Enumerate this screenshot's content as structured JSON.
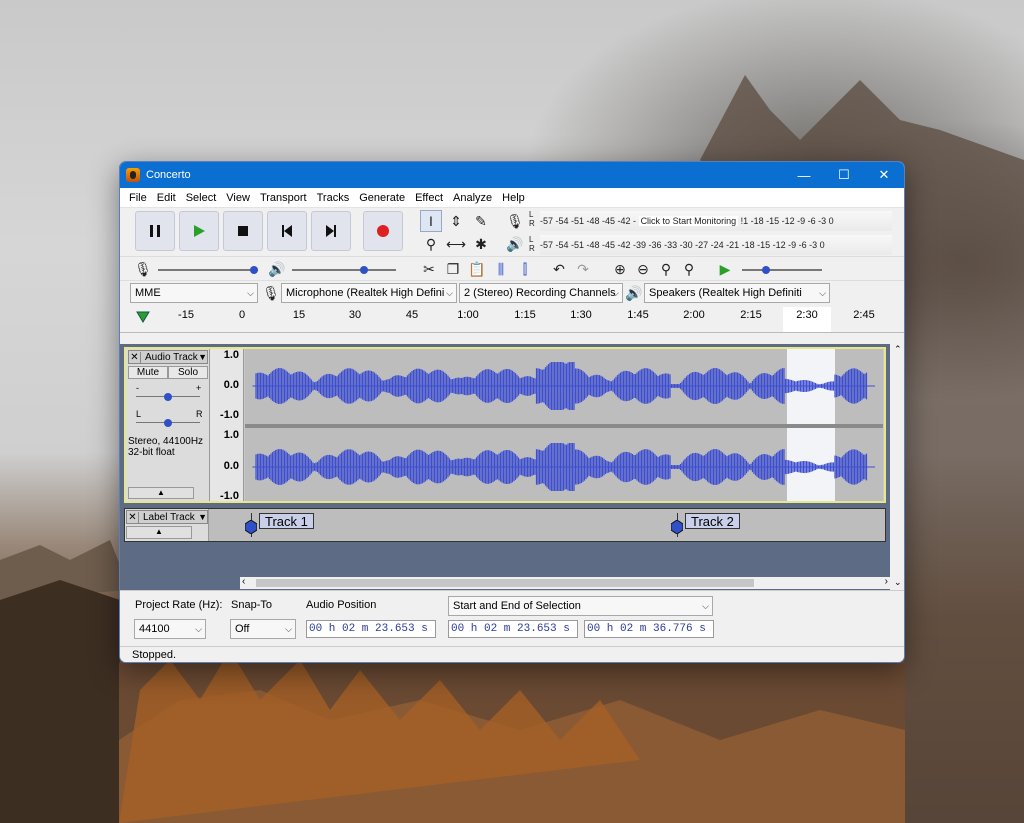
{
  "window": {
    "title": "Concerto",
    "minimize": "—",
    "maximize": "☐",
    "close": "✕"
  },
  "menu": [
    "File",
    "Edit",
    "Select",
    "View",
    "Transport",
    "Tracks",
    "Generate",
    "Effect",
    "Analyze",
    "Help"
  ],
  "meters": {
    "record_scale": "-57 -54 -51 -48 -45 -42 -",
    "record_prompt": "Click to Start Monitoring",
    "record_scale_end": "!1 -18 -15 -12 -9 -6 -3 0",
    "play_scale": "-57 -54 -51 -48 -45 -42 -39 -36 -33 -30 -27 -24 -21 -18 -15 -12 -9 -6 -3 0",
    "l": "L",
    "r": "R"
  },
  "device": {
    "host": "MME",
    "mic": "Microphone (Realtek High Defini",
    "channels": "2 (Stereo) Recording Channels",
    "speaker": "Speakers (Realtek High Definiti"
  },
  "ruler": [
    "-15",
    "0",
    "15",
    "30",
    "45",
    "1:00",
    "1:15",
    "1:30",
    "1:45",
    "2:00",
    "2:15",
    "2:30",
    "2:45"
  ],
  "audio_track": {
    "name": "Audio Track",
    "mute": "Mute",
    "solo": "Solo",
    "gain_minus": "-",
    "gain_plus": "+",
    "pan_l": "L",
    "pan_r": "R",
    "info1": "Stereo, 44100Hz",
    "info2": "32-bit float",
    "scale_top": "1.0",
    "scale_mid": "0.0",
    "scale_bot": "-1.0"
  },
  "label_track": {
    "name": "Label Track",
    "labels": [
      "Track 1",
      "Track 2"
    ]
  },
  "selection": {
    "rate_label": "Project Rate (Hz):",
    "rate_value": "44100",
    "snap_label": "Snap-To",
    "snap_value": "Off",
    "position_label": "Audio Position",
    "position_value": "00 h 02 m 23.653 s",
    "sel_mode": "Start and End of Selection",
    "sel_start": "00 h 02 m 23.653 s",
    "sel_end": "00 h 02 m 36.776 s"
  },
  "status": "Stopped."
}
